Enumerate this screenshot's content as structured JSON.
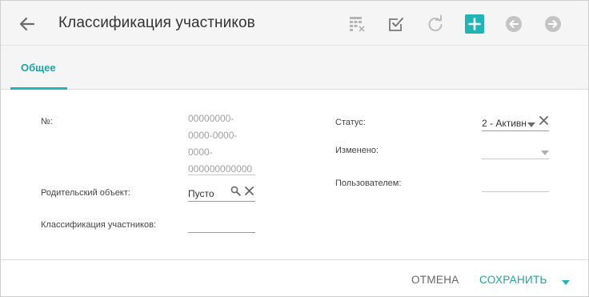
{
  "header": {
    "title": "Классификация участников",
    "icons": [
      "back-arrow-icon",
      "grid-clear-icon",
      "checkbox-check-icon",
      "refresh-icon",
      "add-icon",
      "previous-icon",
      "next-icon"
    ],
    "accent": "#1fb5b5"
  },
  "tabs": [
    {
      "label": "Общее",
      "active": true
    }
  ],
  "form": {
    "number_label": "№:",
    "number_value_lines": [
      "00000000-",
      "0000-0000-",
      "0000-",
      "000000000000"
    ],
    "parent_label": "Родительский объект:",
    "parent_value": "Пусто",
    "classification_label": "Классификация участников:",
    "classification_value": "",
    "status_label": "Статус:",
    "status_value": "2 - Активн",
    "changed_label": "Изменено:",
    "changed_value": "",
    "user_label": "Пользователем:",
    "user_value": ""
  },
  "footer": {
    "cancel_label": "ОТМЕНА",
    "save_label": "СОХРАНИТЬ"
  }
}
